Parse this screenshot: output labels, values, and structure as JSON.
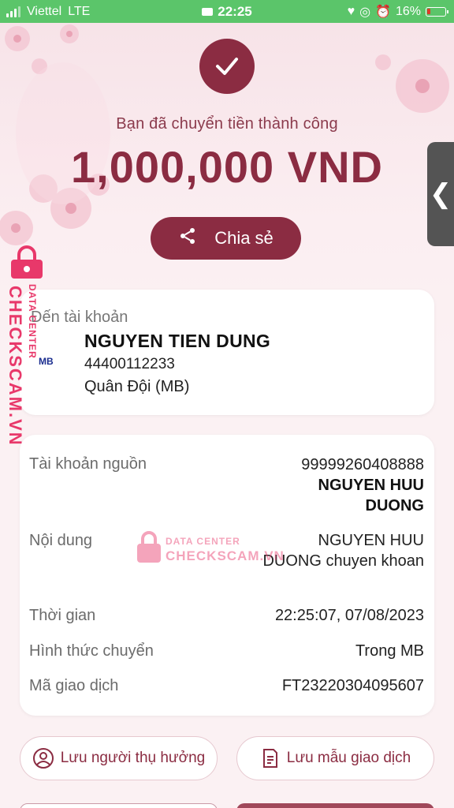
{
  "status_bar": {
    "carrier": "Viettel",
    "network": "LTE",
    "time": "22:25",
    "battery": "16%"
  },
  "header": {
    "success_text": "Bạn đã chuyển tiền thành công",
    "amount": "1,000,000 VND",
    "share_label": "Chia sẻ",
    "side_tab_glyph": "❮"
  },
  "watermark": {
    "vertical_text": "CHECKSCAM.VN",
    "vertical_small": "DATA CENTER",
    "center_line1": "DATA CENTER",
    "center_line2": "CHECKSCAM.VN"
  },
  "recipient": {
    "label": "Đến tài khoản",
    "bank_logo": "MB",
    "name": "NGUYEN TIEN DUNG",
    "account": "44400112233",
    "bank": "Quân Đội (MB)"
  },
  "details": {
    "source_label": "Tài khoản nguồn",
    "source_account": "99999260408888",
    "source_name_line1": "NGUYEN HUU",
    "source_name_line2": "DUONG",
    "content_label": "Nội dung",
    "content_line1": "NGUYEN HUU",
    "content_line2": "DUONG chuyen khoan",
    "time_label": "Thời gian",
    "time_value": "22:25:07, 07/08/2023",
    "method_label": "Hình thức chuyển",
    "method_value": "Trong MB",
    "txn_label": "Mã giao dịch",
    "txn_value": "FT23220304095607"
  },
  "actions": {
    "save_beneficiary": "Lưu người thụ hưởng",
    "save_template": "Lưu mẫu giao dịch"
  },
  "colors": {
    "brand": "#8b2c42",
    "status_bar": "#5bc56a",
    "watermark": "#e8386a"
  }
}
